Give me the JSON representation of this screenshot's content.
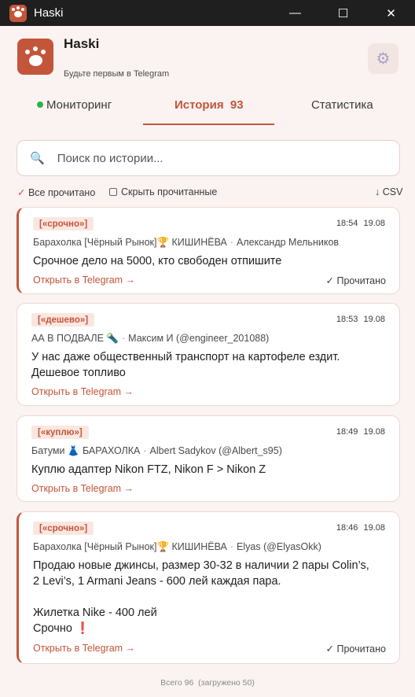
{
  "window": {
    "title": "Haski",
    "minimize_glyph": "—",
    "maximize_glyph": "☐",
    "close_glyph": "✕"
  },
  "header": {
    "app_name": "Haski",
    "subtitle": "Будьте первым в Telegram",
    "settings_icon": "gear-icon"
  },
  "tabs": [
    {
      "label": "Мониторинг",
      "status": "online"
    },
    {
      "label": "История",
      "count": "93",
      "active": true
    },
    {
      "label": "Статистика"
    }
  ],
  "search": {
    "placeholder": "Поиск по истории..."
  },
  "toolbar": {
    "mark_all_read": "Все прочитано",
    "hide_read": "Скрыть прочитанные",
    "export_csv": "CSV"
  },
  "messages": [
    {
      "tag": "[«срочно»]",
      "time": "18:54",
      "date": "19.08",
      "channel": "Барахолка [Чёрный Рынок]🏆 КИШИНЁВА",
      "author": "Александр Мельников",
      "text": "Срочное дело на 5000, кто свободен отпишите",
      "open_link": "Открыть в Telegram →",
      "read_status": "✓ Прочитано",
      "unread": true
    },
    {
      "tag": "[«дешево»]",
      "time": "18:53",
      "date": "19.08",
      "channel": "АА В ПОДВАЛЕ 🔦",
      "author": "Максим И (@engineer_201088)",
      "text": "У нас даже общественный транспорт на картофеле ездит.\nДешевое топливо",
      "open_link": "Открыть в Telegram →",
      "unread": false
    },
    {
      "tag": "[«куплю»]",
      "time": "18:49",
      "date": "19.08",
      "channel": "Батуми 👗 БАРАХОЛКА",
      "author": "Albert Sadykov (@Albert_s95)",
      "text": "Куплю адаптер Nikon FTZ, Nikon F > Nikon Z",
      "open_link": "Открыть в Telegram →",
      "unread": false
    },
    {
      "tag": "[«срочно»]",
      "time": "18:46",
      "date": "19.08",
      "channel": "Барахолка [Чёрный Рынок]🏆 КИШИНЁВА",
      "author": "Elyas (@ElyasOkk)",
      "text": "Продаю новые джинсы, размер 30-32 в наличии 2 пары Colin’s,\n2 Levi’s, 1 Armani Jeans - 600 лей каждая пара.\n\nЖилетка Nike - 400 лей\nСрочно",
      "text_suffix": "❗",
      "open_link": "Открыть в Telegram →",
      "read_status": "✓ Прочитано",
      "unread": true
    }
  ],
  "footer": {
    "total": "Всего 96",
    "loaded": "(загружено 50)"
  },
  "colors": {
    "accent": "#c3553a",
    "background": "#fbf3f1",
    "online": "#2bb34b"
  }
}
